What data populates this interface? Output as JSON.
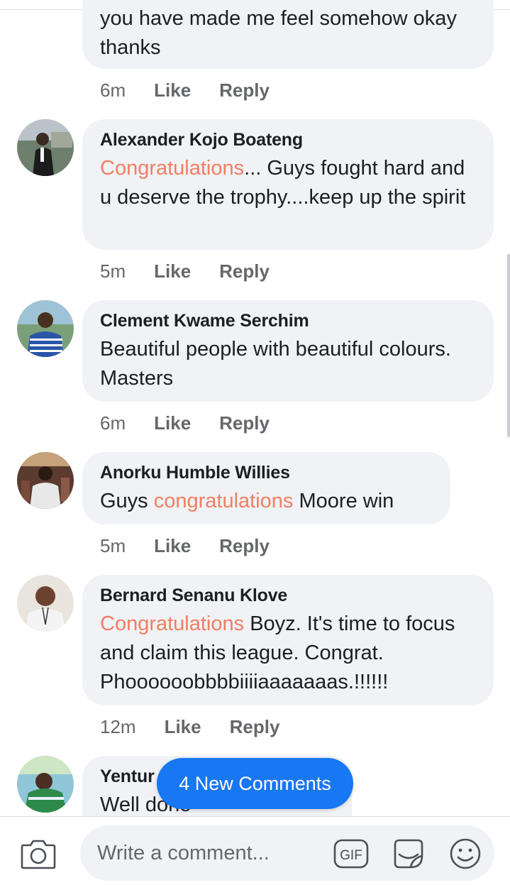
{
  "comments": [
    {
      "id": "c0",
      "name": "",
      "text_parts": [
        {
          "t": "you have made me feel somehow okay thanks",
          "hl": false
        }
      ],
      "time": "6m",
      "like": "Like",
      "reply": "Reply"
    },
    {
      "id": "c1",
      "name": "Alexander Kojo Boateng",
      "text_parts": [
        {
          "t": "Congratulations",
          "hl": true
        },
        {
          "t": "...  Guys fought hard and u deserve the trophy....keep up the spirit",
          "hl": false
        }
      ],
      "time": "5m",
      "like": "Like",
      "reply": "Reply"
    },
    {
      "id": "c2",
      "name": "Clement Kwame Serchim",
      "text_parts": [
        {
          "t": "Beautiful people with beautiful colours. Masters",
          "hl": false
        }
      ],
      "time": "6m",
      "like": "Like",
      "reply": "Reply"
    },
    {
      "id": "c3",
      "name": "Anorku Humble Willies",
      "text_parts": [
        {
          "t": "Guys ",
          "hl": false
        },
        {
          "t": "congratulations",
          "hl": true
        },
        {
          "t": " Moore win",
          "hl": false
        }
      ],
      "time": "5m",
      "like": "Like",
      "reply": "Reply"
    },
    {
      "id": "c4",
      "name": "Bernard Senanu Klove",
      "text_parts": [
        {
          "t": "Congratulations",
          "hl": true
        },
        {
          "t": " Boyz. It's time to focus and claim this league. Congrat. Phoooooobbbbiiiiaaaaaaas.!!!!!!",
          "hl": false
        }
      ],
      "time": "12m",
      "like": "Like",
      "reply": "Reply"
    },
    {
      "id": "c5",
      "name": "Yentur",
      "text_parts": [
        {
          "t": "Well done",
          "hl": false
        }
      ],
      "time": "",
      "like": "",
      "reply": ""
    }
  ],
  "new_comments_label": "4 New Comments",
  "composer": {
    "placeholder": "Write a comment...",
    "gif_label": "GIF"
  },
  "colors": {
    "highlight": "#f07e62",
    "bubble": "#f0f2f5",
    "accent": "#1877f2",
    "meta": "#65676b"
  },
  "icons": [
    "camera-icon",
    "gif-icon",
    "sticker-icon",
    "emoji-icon"
  ]
}
